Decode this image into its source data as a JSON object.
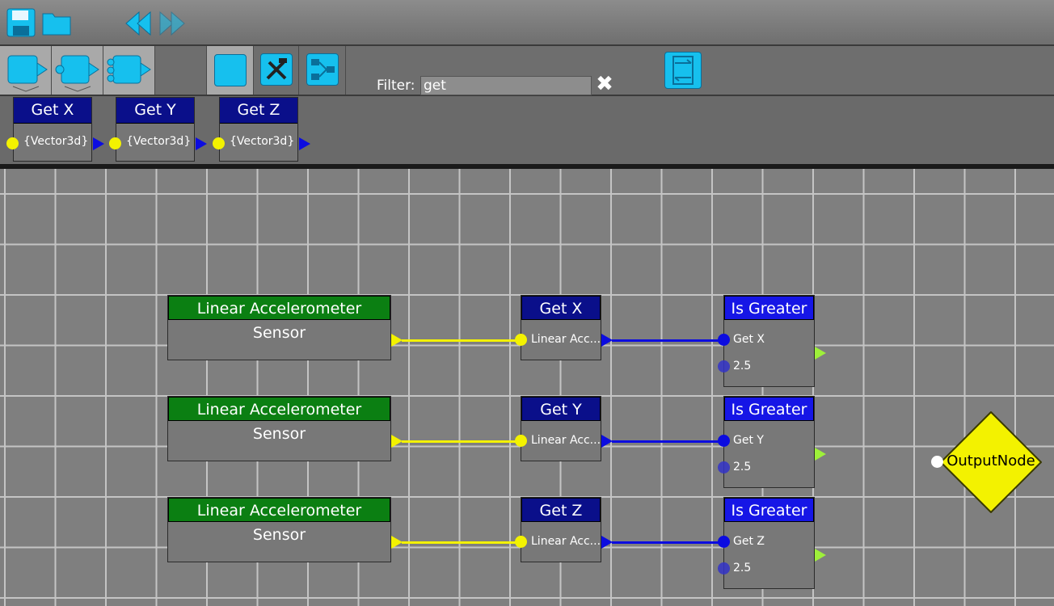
{
  "filter": {
    "label": "Filter:",
    "value": "get",
    "clear": "✖"
  },
  "palette": [
    {
      "title": "Get X",
      "param": "{Vector3d}"
    },
    {
      "title": "Get Y",
      "param": "{Vector3d}"
    },
    {
      "title": "Get Z",
      "param": "{Vector3d}"
    }
  ],
  "graph": {
    "sensor_title": "Linear Accelerometer Sensor",
    "getters": [
      {
        "title": "Get X",
        "input": "Linear Acc..."
      },
      {
        "title": "Get Y",
        "input": "Linear Acc..."
      },
      {
        "title": "Get Z",
        "input": "Linear Acc..."
      }
    ],
    "comparators": [
      {
        "title": "Is Greater",
        "a": "Get X",
        "b": "2.5"
      },
      {
        "title": "Is Greater",
        "a": "Get Y",
        "b": "2.5"
      },
      {
        "title": "Is Greater",
        "a": "Get Z",
        "b": "2.5"
      }
    ],
    "output_node": "OutputNode"
  },
  "colors": {
    "accent": "#16c0ee",
    "sensor_header": "#0b7f12",
    "getter_header": "#0a0f8a",
    "compare_header": "#1616e6",
    "wire_data": "#f3f200",
    "wire_value": "#0c0ce0",
    "output_node": "#f3f200"
  },
  "icons": [
    "save-icon",
    "open-folder-icon",
    "undo-icon",
    "redo-icon",
    "node-output-icon",
    "node-inout-icon",
    "node-multi-icon",
    "stop-icon",
    "build-icon",
    "flow-icon",
    "swap-icon",
    "clear-icon"
  ]
}
